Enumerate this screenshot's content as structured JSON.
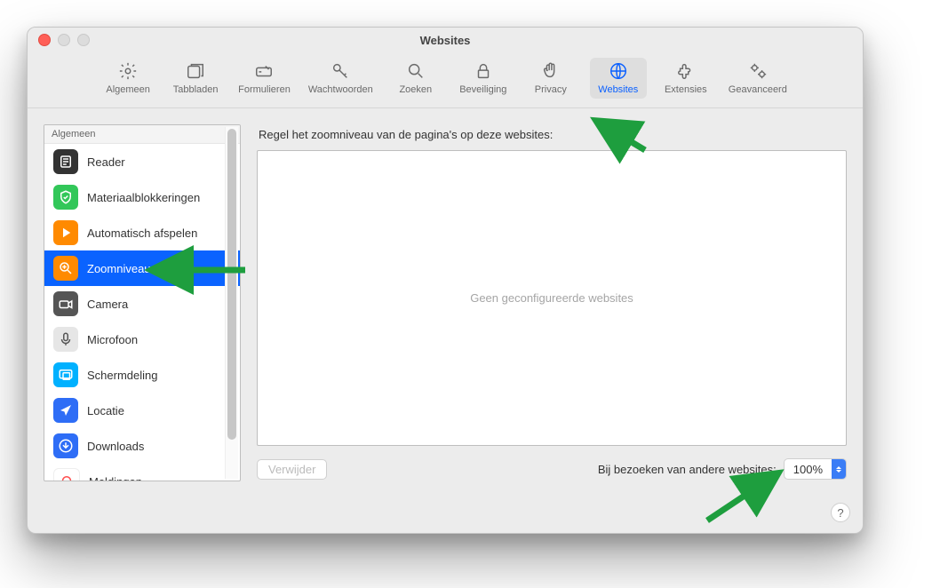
{
  "window": {
    "title": "Websites"
  },
  "toolbar": [
    {
      "id": "general",
      "label": "Algemeen"
    },
    {
      "id": "tabs",
      "label": "Tabbladen"
    },
    {
      "id": "forms",
      "label": "Formulieren"
    },
    {
      "id": "passwords",
      "label": "Wachtwoorden"
    },
    {
      "id": "search",
      "label": "Zoeken"
    },
    {
      "id": "security",
      "label": "Beveiliging"
    },
    {
      "id": "privacy",
      "label": "Privacy"
    },
    {
      "id": "websites",
      "label": "Websites"
    },
    {
      "id": "extensions",
      "label": "Extensies"
    },
    {
      "id": "advanced",
      "label": "Geavanceerd"
    }
  ],
  "sidebar": {
    "header": "Algemeen",
    "items": [
      {
        "id": "reader",
        "label": "Reader"
      },
      {
        "id": "blockers",
        "label": "Materiaalblokkeringen"
      },
      {
        "id": "autoplay",
        "label": "Automatisch afspelen"
      },
      {
        "id": "zoom",
        "label": "Zoomniveau"
      },
      {
        "id": "camera",
        "label": "Camera"
      },
      {
        "id": "microphone",
        "label": "Microfoon"
      },
      {
        "id": "screenshare",
        "label": "Schermdeling"
      },
      {
        "id": "location",
        "label": "Locatie"
      },
      {
        "id": "downloads",
        "label": "Downloads"
      },
      {
        "id": "notifications",
        "label": "Meldingen"
      }
    ]
  },
  "main": {
    "heading": "Regel het zoomniveau van de pagina's op deze websites:",
    "empty": "Geen geconfigureerde websites",
    "remove_button": "Verwijder",
    "default_label": "Bij bezoeken van andere websites:",
    "default_value": "100%"
  },
  "help": "?"
}
